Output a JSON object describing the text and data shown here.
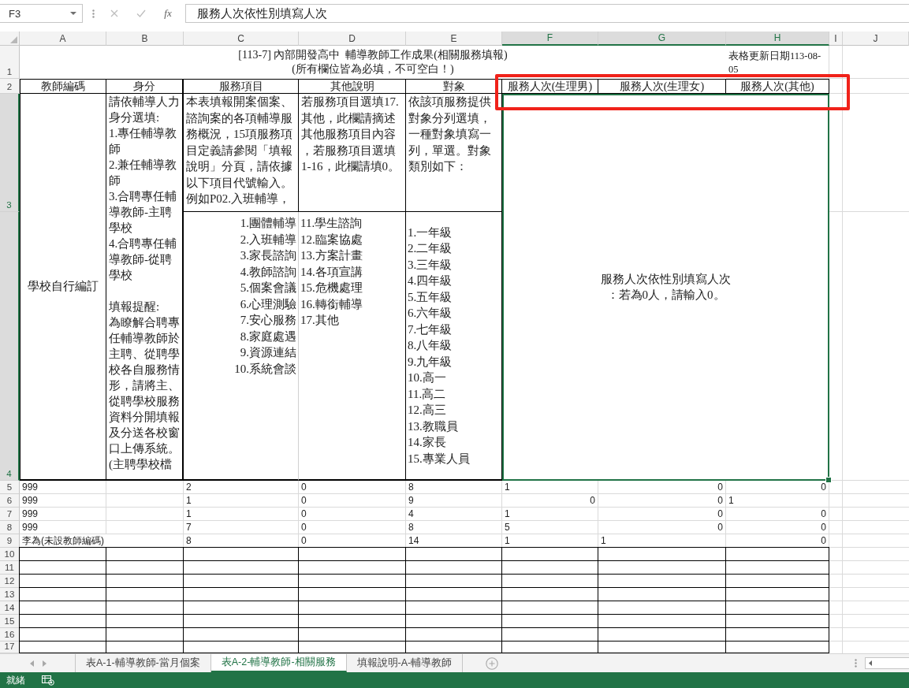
{
  "formula_bar": {
    "name_box": "F3",
    "buttons": [
      {
        "kind": "cancel",
        "disabled": true
      },
      {
        "kind": "enter",
        "disabled": true
      },
      {
        "kind": "function",
        "label": "fx",
        "disabled": false
      }
    ],
    "formula": "服務人次依性別填寫人次"
  },
  "sheet": {
    "columns": [
      {
        "label": "A",
        "selected": false
      },
      {
        "label": "B",
        "selected": false
      },
      {
        "label": "C",
        "selected": false
      },
      {
        "label": "D",
        "selected": false
      },
      {
        "label": "E",
        "selected": false
      },
      {
        "label": "F",
        "selected": true
      },
      {
        "label": "G",
        "selected": true
      },
      {
        "label": "H",
        "selected": true
      },
      {
        "label": "I",
        "selected": false
      },
      {
        "label": "J",
        "selected": false
      }
    ],
    "rows": [
      {
        "label": "1",
        "selected": false
      },
      {
        "label": "2",
        "selected": false
      },
      {
        "label": "3",
        "selected": true
      },
      {
        "label": "4",
        "selected": true
      },
      {
        "label": "5",
        "selected": false
      },
      {
        "label": "6",
        "selected": false
      },
      {
        "label": "7",
        "selected": false
      },
      {
        "label": "8",
        "selected": false
      },
      {
        "label": "9",
        "selected": false
      },
      {
        "label": "10",
        "selected": false
      },
      {
        "label": "11",
        "selected": false
      },
      {
        "label": "12",
        "selected": false
      },
      {
        "label": "13",
        "selected": false
      },
      {
        "label": "14",
        "selected": false
      },
      {
        "label": "15",
        "selected": false
      },
      {
        "label": "16",
        "selected": false
      },
      {
        "label": "17",
        "selected": false
      }
    ],
    "title_lines": [
      "[113-7] 內部開發高中  輔導教師工作成果(相關服務填報)",
      "(所有欄位皆為必填，不可空白！)"
    ],
    "update_note": "表格更新日期113-08-05",
    "headers": [
      "教師編碼",
      "身分",
      "服務項目",
      "其他說明",
      "對象"
    ],
    "highlighted_headers": [
      "服務人次(生理男)",
      "服務人次(生理女)",
      "服務人次(其他)"
    ],
    "id_note": "學校自行編訂",
    "identity_options": [
      "請依輔導人力身分選填:",
      "1.專任輔導教師",
      "2.兼任輔導教師",
      "3.合聘專任輔導教師-主聘學校",
      "4.合聘專任輔導教師-從聘學校"
    ],
    "reminder": [
      "填報提醒:",
      "為瞭解合聘專任輔導教師於主聘、從聘學校各自服務情形，請將主、從聘學校服務資料分開填報及分送各校窗口上傳系統。(主聘學校檔"
    ],
    "service_note": "本表填報開案個案、諮詢案的各項輔導服務概況，15項服務項目定義請參閱「填報說明」分頁，請依據以下項目代號輸入。例如P02.入班輔導，",
    "other_note": "若服務項目選填17.其他，此欄請摘述其他服務項目內容，若服務項目選填1-16，此欄請填0。",
    "target_note": "依該項服務提供對象分列選填，一種對象填寫一列，單選。對象類別如下：",
    "service_codes": [
      {
        "items": [
          "1.團體輔導",
          "2.入班輔導",
          "3.家長諮詢",
          "4.教師諮詢",
          "5.個案會議",
          "6.心理測驗",
          "7.安心服務",
          "8.家庭處遇",
          "9.資源連結",
          "10.系統會談"
        ]
      },
      {
        "items": [
          "11.學生諮詢",
          "12.臨案協處",
          "13.方案計畫",
          "14.各項宣講",
          "15.危機處理",
          "16.轉銜輔導",
          "17.其他"
        ]
      }
    ],
    "target_codes": [
      "1.一年級",
      "2.二年級",
      "3.三年級",
      "4.四年級",
      "5.五年級",
      "6.六年級",
      "7.七年級",
      "8.八年級",
      "9.九年級",
      "10.高一",
      "11.高二",
      "12.高三",
      "13.教職員",
      "14.家長",
      "15.專業人員"
    ],
    "gender_note": [
      "服務人次依性別填寫人次",
      "：若為0人，請輸入0。"
    ],
    "data_rows": [
      {
        "bordered": false,
        "cells": {
          "A": {
            "value": "999",
            "kind": "text"
          },
          "C": {
            "value": "2",
            "kind": "text"
          },
          "D": {
            "value": "0",
            "kind": "text"
          },
          "E": {
            "value": "8",
            "kind": "text"
          },
          "F": {
            "value": "1",
            "kind": "text"
          },
          "G": {
            "value": "0",
            "kind": "number"
          },
          "H": {
            "value": "0",
            "kind": "number"
          }
        }
      },
      {
        "bordered": false,
        "cells": {
          "A": {
            "value": "999",
            "kind": "text"
          },
          "C": {
            "value": "1",
            "kind": "text"
          },
          "D": {
            "value": "0",
            "kind": "text"
          },
          "E": {
            "value": "9",
            "kind": "text"
          },
          "F": {
            "value": "0",
            "kind": "number"
          },
          "G": {
            "value": "0",
            "kind": "number"
          },
          "H": {
            "value": "1",
            "kind": "text"
          }
        }
      },
      {
        "bordered": false,
        "cells": {
          "A": {
            "value": "999",
            "kind": "text"
          },
          "C": {
            "value": "1",
            "kind": "text"
          },
          "D": {
            "value": "0",
            "kind": "text"
          },
          "E": {
            "value": "4",
            "kind": "text"
          },
          "F": {
            "value": "1",
            "kind": "text"
          },
          "G": {
            "value": "0",
            "kind": "number"
          },
          "H": {
            "value": "0",
            "kind": "number"
          }
        }
      },
      {
        "bordered": false,
        "cells": {
          "A": {
            "value": "999",
            "kind": "text"
          },
          "C": {
            "value": "7",
            "kind": "text"
          },
          "D": {
            "value": "0",
            "kind": "text"
          },
          "E": {
            "value": "8",
            "kind": "text"
          },
          "F": {
            "value": "5",
            "kind": "text"
          },
          "G": {
            "value": "0",
            "kind": "number"
          },
          "H": {
            "value": "0",
            "kind": "number"
          }
        }
      },
      {
        "bordered": false,
        "cells": {
          "A": {
            "value": "李為(未設教師編碼)",
            "kind": "text"
          },
          "C": {
            "value": "8",
            "kind": "text"
          },
          "D": {
            "value": "0",
            "kind": "text"
          },
          "E": {
            "value": "14",
            "kind": "text"
          },
          "F": {
            "value": "1",
            "kind": "text"
          },
          "G": {
            "value": "1",
            "kind": "text"
          },
          "H": {
            "value": "0",
            "kind": "number"
          }
        }
      },
      {
        "bordered": true
      },
      {
        "bordered": true
      },
      {
        "bordered": true
      },
      {
        "bordered": true
      },
      {
        "bordered": true
      },
      {
        "bordered": true
      },
      {
        "bordered": true
      },
      {
        "bordered": true
      }
    ]
  },
  "sheet_tabs": [
    {
      "label": "表A-1-輔導教師-當月個案",
      "selected": false
    },
    {
      "label": "表A-2-輔導教師-相關服務",
      "selected": true
    },
    {
      "label": "填報說明-A-輔導教師",
      "selected": false
    }
  ],
  "status_bar": {
    "text": "就緒"
  }
}
